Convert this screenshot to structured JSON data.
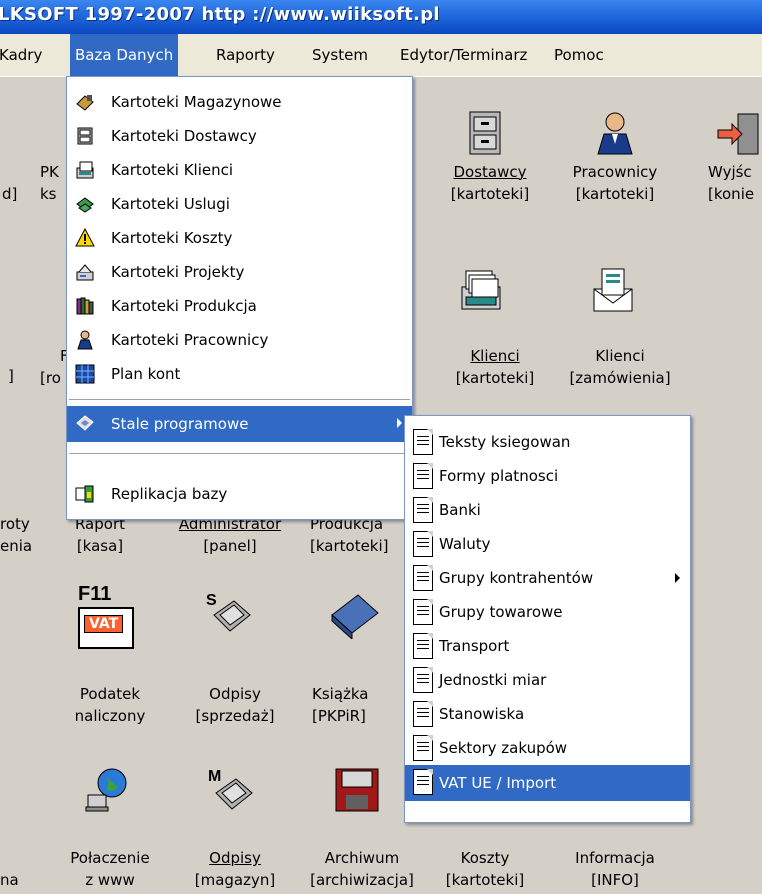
{
  "window": {
    "title": "LKSOFT 1997-2007  http ://www.wiiksoft.pl"
  },
  "menubar": {
    "items": [
      "Kadry",
      "Baza Danych",
      "Raporty",
      "System",
      "Edytor/Terminarz",
      "Pomoc"
    ],
    "active": "Baza Danych"
  },
  "baza_menu": {
    "items": [
      {
        "label": "Kartoteki Magazynowe",
        "icon": "warehouse-icon"
      },
      {
        "label": "Kartoteki Dostawcy",
        "icon": "cabinet-icon"
      },
      {
        "label": "Kartoteki Klienci",
        "icon": "card-file-icon"
      },
      {
        "label": "Kartoteki Uslugi",
        "icon": "money-icon"
      },
      {
        "label": "Kartoteki Koszty",
        "icon": "warning-icon"
      },
      {
        "label": "Kartoteki Projekty",
        "icon": "project-icon"
      },
      {
        "label": "Kartoteki Produkcja",
        "icon": "books-icon"
      },
      {
        "label": "Kartoteki Pracownicy",
        "icon": "worker-icon"
      },
      {
        "label": "Plan kont",
        "icon": "table-icon"
      },
      {
        "label": "Stale programowe",
        "icon": "diamond-icon"
      },
      {
        "label": "Replikacja bazy",
        "icon": "replication-icon"
      }
    ]
  },
  "stale_menu": {
    "items": [
      "Teksty ksiegowan",
      "Formy platnosci",
      "Banki",
      "Waluty",
      "Grupy kontrahentów",
      "Grupy towarowe",
      "Transport",
      "Jednostki miar",
      "Stanowiska",
      "Sektory zakupów",
      "VAT UE / Import"
    ],
    "highlighted": "VAT UE / Import"
  },
  "desktop": {
    "dostawcy": [
      "Dostawcy",
      "[kartoteki]"
    ],
    "pracownicy": [
      "Pracownicy",
      "[kartoteki]"
    ],
    "wyjscie": [
      "Wyjśc",
      "[konie"
    ],
    "klienci": [
      "Klienci",
      "[kartoteki]"
    ],
    "klienci_zam": [
      "Klienci",
      "[zamówienia]"
    ],
    "pk": [
      "PK",
      "ks"
    ],
    "left1": [
      "d]"
    ],
    "left2": [
      "]"
    ],
    "ro": [
      "F",
      "[ro"
    ],
    "zwroty": [
      "roty",
      "enia"
    ],
    "raport": [
      "Raport",
      "[kasa]"
    ],
    "admin": [
      "Administrator",
      "[panel]"
    ],
    "produkcja": [
      "Produkcja",
      "[kartoteki]"
    ],
    "podatek": [
      "Podatek",
      "naliczony"
    ],
    "odpisy_sp": [
      "Odpisy",
      "[sprzedaż]"
    ],
    "ksiazka": [
      "Książka",
      "[PKPiR]"
    ],
    "polaczenie": [
      "Połaczenie",
      "z www"
    ],
    "odpisy_mag": [
      "Odpisy",
      "[magazyn]"
    ],
    "archiwum": [
      "Archiwum",
      "[archiwizacja]"
    ],
    "koszty": [
      "Koszty",
      "[kartoteki]"
    ],
    "informacja": [
      "Informacja",
      "[INFO]"
    ],
    "na": [
      "na"
    ],
    "vat_icon_text": "VAT",
    "f11": "F11",
    "pkp_text": "PKP IR",
    "s_letter": "S",
    "m_letter": "M"
  }
}
